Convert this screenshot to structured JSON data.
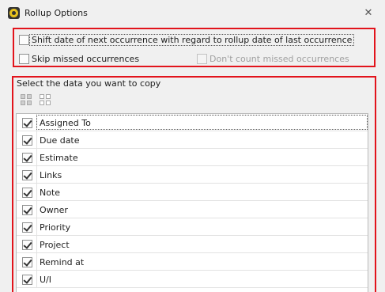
{
  "window": {
    "title": "Rollup Options",
    "close_glyph": "✕"
  },
  "options": {
    "shift_date_label": "Shift date of next occurrence with regard to rollup date of last occurrence",
    "shift_date_checked": false,
    "skip_missed_label": "Skip missed occurrences",
    "skip_missed_checked": false,
    "dont_count_label": "Don't count missed occurrences",
    "dont_count_checked": false,
    "dont_count_enabled": false
  },
  "copy_section": {
    "label": "Select the data you want to copy",
    "select_all_icon": "select-all-icon",
    "deselect_all_icon": "deselect-all-icon",
    "items": [
      {
        "label": "Assigned To",
        "checked": true
      },
      {
        "label": "Due date",
        "checked": true
      },
      {
        "label": "Estimate",
        "checked": true
      },
      {
        "label": "Links",
        "checked": true
      },
      {
        "label": "Note",
        "checked": true
      },
      {
        "label": "Owner",
        "checked": true
      },
      {
        "label": "Priority",
        "checked": true
      },
      {
        "label": "Project",
        "checked": true
      },
      {
        "label": "Remind at",
        "checked": true
      },
      {
        "label": "U/I",
        "checked": true
      }
    ]
  },
  "colors": {
    "highlight_border": "#e2141c",
    "window_bg": "#f0f0f0"
  }
}
